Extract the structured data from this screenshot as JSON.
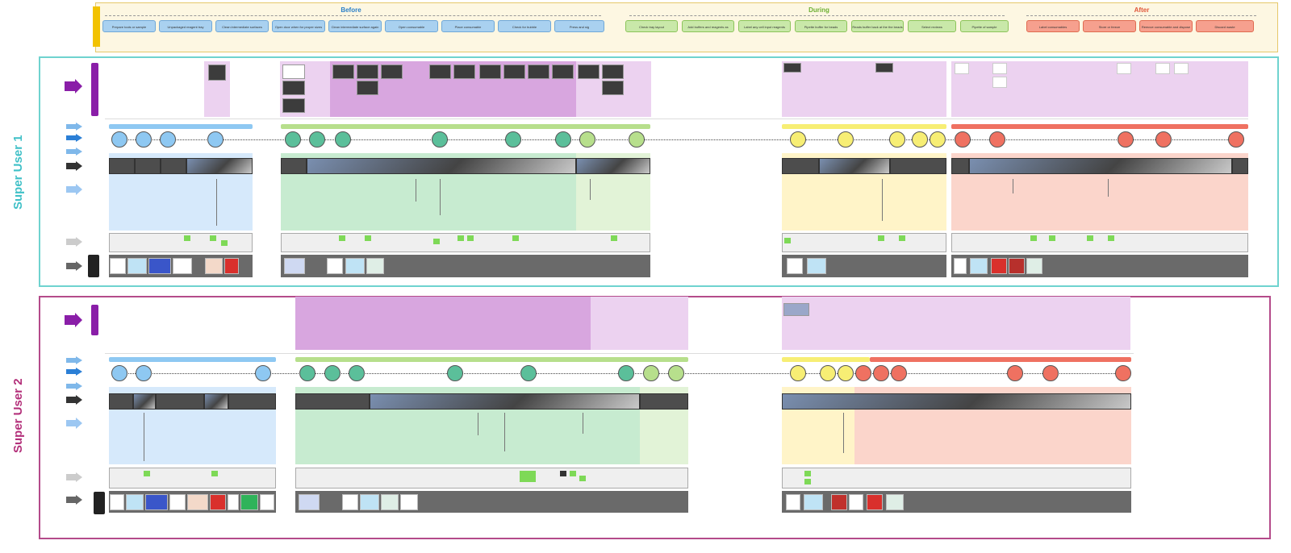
{
  "summary": {
    "phases": [
      {
        "key": "before",
        "label": "Before"
      },
      {
        "key": "during",
        "label": "During"
      },
      {
        "key": "after",
        "label": "After"
      }
    ],
    "steps_before": [
      "Prepare tools or sample",
      "Unpackaged reagent tray",
      "Clean intermediate surfaces",
      "Open door when for proper sizes",
      "Clean intermediate surface again optionally notes",
      "Open consumable",
      "Place consumable",
      "Check for bubble",
      "Press and sig"
    ],
    "steps_during": [
      "Check tray layout",
      "Add buffers and reagents as necessary",
      "Label any cell input reagents",
      "Pipette buffer for beads",
      "Reads buffer back at the the beads",
      "Select reviews",
      "Pipette of sample"
    ],
    "steps_after": [
      "Label consumables",
      "Store or freeze",
      "Remove consumable and dispose or clean",
      "Discard waste"
    ]
  },
  "users": [
    {
      "label": "Super User 1"
    },
    {
      "label": "Super User 2"
    }
  ],
  "colors": {
    "before": "#a9d1f0",
    "during": "#c9e8a9",
    "after": "#f6a08e",
    "user1": "#3fc0c7",
    "user2": "#b3307a"
  },
  "icons": [
    "arrow-right-icon",
    "glove-icon",
    "pipette-icon",
    "tube-rack-icon",
    "box-icon",
    "photo-icon"
  ]
}
